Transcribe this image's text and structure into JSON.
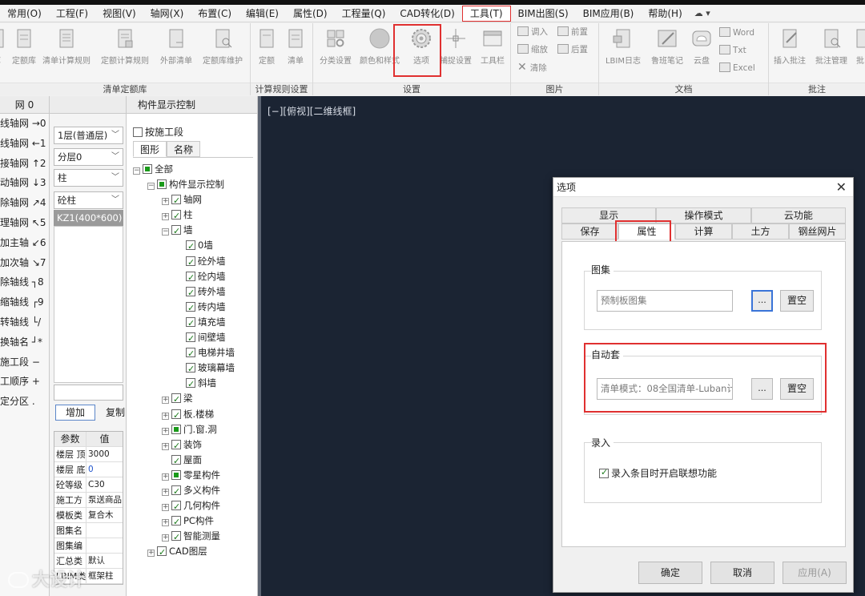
{
  "menubar": {
    "items": [
      "常用(O)",
      "工程(F)",
      "视图(V)",
      "轴网(X)",
      "布置(C)",
      "编辑(E)",
      "属性(D)",
      "工程量(Q)",
      "CAD转化(D)",
      "工具(T)",
      "BIM出图(S)",
      "BIM应用(B)",
      "帮助(H)",
      "☁ ▾"
    ],
    "active": "工具(T)"
  },
  "ribbon": {
    "group1": {
      "label": "清单定额库",
      "buttons": [
        "库",
        "定额库",
        "清单计算规则",
        "定额计算规则",
        "外部清单",
        "定额库维护"
      ]
    },
    "group2": {
      "label": "计算规则设置",
      "buttons": [
        "定额",
        "清单"
      ]
    },
    "group3": {
      "label": "设置",
      "buttons": [
        "分类设置",
        "颜色和样式",
        "选项",
        "捕捉设置",
        "工具栏"
      ]
    },
    "group4": {
      "label": "图片",
      "small": [
        "调入",
        "缩放",
        "清除",
        "前置",
        "后置"
      ]
    },
    "group5": {
      "label": "文档",
      "buttons": [
        "LBIM日志",
        "鲁班笔记",
        "云盘"
      ],
      "small": [
        "Word",
        "Txt",
        "Excel"
      ]
    },
    "group6": {
      "label": "批注",
      "buttons": [
        "插入批注",
        "批注管理",
        "批"
      ]
    }
  },
  "panel1": {
    "header": "网 0",
    "rows": [
      "线轴网 →0",
      "线轴网 ←1",
      "接轴网 ↑2",
      "动轴网 ↓3",
      "除轴网 ↗4",
      "理轴网 ↖5",
      "加主轴 ↙6",
      "加次轴 ↘7",
      "除轴线 ┐8",
      "缩轴线 ┌9",
      "转轴线 └/",
      "换轴名 ┘*",
      "施工段 −",
      "工顺序 +",
      "定分区 ."
    ]
  },
  "panel2": {
    "floor": "1层(普通层)",
    "layer": "分层0",
    "category": "柱",
    "subcategory": "砼柱",
    "selected": "KZ1(400*600)",
    "add_button": "增加",
    "copy_button": "复制",
    "params_header": [
      "参数",
      "值"
    ],
    "params": [
      {
        "k": "楼层 顶",
        "v": "3000"
      },
      {
        "k": "楼层 底",
        "v": "0"
      },
      {
        "k": "砼等级",
        "v": "C30"
      },
      {
        "k": "施工方",
        "v": "泵送商品"
      },
      {
        "k": "模板类",
        "v": "复合木"
      },
      {
        "k": "图集名",
        "v": ""
      },
      {
        "k": "图集编",
        "v": ""
      },
      {
        "k": "汇总类",
        "v": "默认"
      },
      {
        "k": "LBIM类",
        "v": "框架柱"
      }
    ]
  },
  "panel3": {
    "title": "构件显示控制",
    "checkbox_label": "按施工段",
    "tabs": [
      "图形",
      "名称"
    ],
    "tree": [
      {
        "label": "全部",
        "level": 0,
        "pm": "−",
        "state": "part"
      },
      {
        "label": "构件显示控制",
        "level": 1,
        "pm": "−",
        "state": "part"
      },
      {
        "label": "轴网",
        "level": 2,
        "pm": "+",
        "state": "on"
      },
      {
        "label": "柱",
        "level": 2,
        "pm": "+",
        "state": "on"
      },
      {
        "label": "墙",
        "level": 2,
        "pm": "−",
        "state": "on"
      },
      {
        "label": "0墙",
        "level": 3,
        "pm": "",
        "state": "on"
      },
      {
        "label": "砼外墙",
        "level": 3,
        "pm": "",
        "state": "on"
      },
      {
        "label": "砼内墙",
        "level": 3,
        "pm": "",
        "state": "on"
      },
      {
        "label": "砖外墙",
        "level": 3,
        "pm": "",
        "state": "on"
      },
      {
        "label": "砖内墙",
        "level": 3,
        "pm": "",
        "state": "on"
      },
      {
        "label": "填充墙",
        "level": 3,
        "pm": "",
        "state": "on"
      },
      {
        "label": "间壁墙",
        "level": 3,
        "pm": "",
        "state": "on"
      },
      {
        "label": "电梯井墙",
        "level": 3,
        "pm": "",
        "state": "on"
      },
      {
        "label": "玻璃幕墙",
        "level": 3,
        "pm": "",
        "state": "on"
      },
      {
        "label": "斜墙",
        "level": 3,
        "pm": "",
        "state": "on"
      },
      {
        "label": "梁",
        "level": 2,
        "pm": "+",
        "state": "on"
      },
      {
        "label": "板.楼梯",
        "level": 2,
        "pm": "+",
        "state": "on"
      },
      {
        "label": "门.窗.洞",
        "level": 2,
        "pm": "+",
        "state": "part"
      },
      {
        "label": "装饰",
        "level": 2,
        "pm": "+",
        "state": "on"
      },
      {
        "label": "屋面",
        "level": 2,
        "pm": "",
        "state": "on"
      },
      {
        "label": "零星构件",
        "level": 2,
        "pm": "+",
        "state": "part"
      },
      {
        "label": "多义构件",
        "level": 2,
        "pm": "+",
        "state": "on"
      },
      {
        "label": "几何构件",
        "level": 2,
        "pm": "+",
        "state": "on"
      },
      {
        "label": "PC构件",
        "level": 2,
        "pm": "+",
        "state": "on"
      },
      {
        "label": "智能测量",
        "level": 2,
        "pm": "+",
        "state": "on"
      },
      {
        "label": "CAD图层",
        "level": 1,
        "pm": "+",
        "state": "on"
      }
    ]
  },
  "canvas": {
    "label": "[−][俯视][二维线框]"
  },
  "dialog": {
    "title": "选项",
    "tabs_row1": [
      "显示",
      "操作模式",
      "云功能"
    ],
    "tabs_row2": [
      "保存",
      "属性",
      "计算",
      "土方",
      "钢丝网片"
    ],
    "active_tab": "属性",
    "section1": {
      "legend": "图集",
      "placeholder": "预制板图集",
      "browse": "...",
      "clear": "置空"
    },
    "section2": {
      "legend": "自动套",
      "value": "清单模式：08全国清单-Luban计",
      "browse": "...",
      "clear": "置空"
    },
    "section3": {
      "legend": "录入",
      "checkbox_label": "录入条目时开启联想功能"
    },
    "ok": "确定",
    "cancel": "取消",
    "apply": "应用(A)"
  },
  "watermark": "大设计"
}
